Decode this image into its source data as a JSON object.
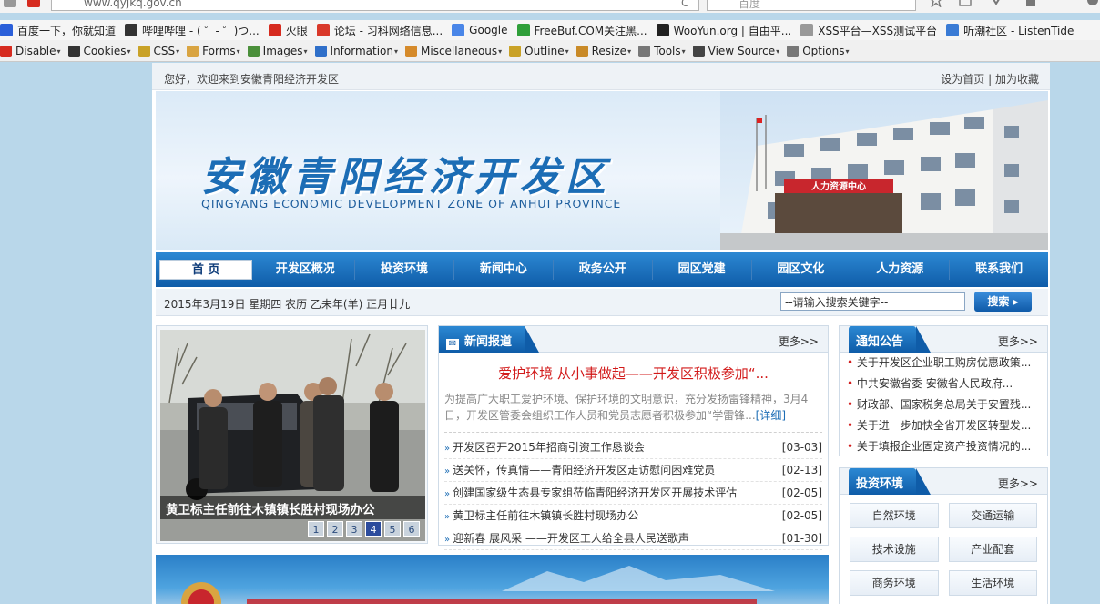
{
  "browser": {
    "url": "www.qyjkq.gov.cn",
    "search_placeholder": "百度",
    "bookmarks": [
      {
        "label": "百度一下，你就知道",
        "icon": "baidu-icon",
        "color": "#2b5fd9"
      },
      {
        "label": "哔哩哔哩 - ( ゜- ゜)つ...",
        "icon": "bilibili-icon",
        "color": "#333333"
      },
      {
        "label": "火眼",
        "icon": "fire-eye-icon",
        "color": "#d62b1f"
      },
      {
        "label": "论坛 - 习科网络信息...",
        "icon": "forum-icon",
        "color": "#d9392a"
      },
      {
        "label": "Google",
        "icon": "google-icon",
        "color": "#4a86e8"
      },
      {
        "label": "FreeBuf.COM关注黑...",
        "icon": "freebuf-icon",
        "color": "#2f9f3a"
      },
      {
        "label": "WooYun.org | 自由平...",
        "icon": "wooyun-icon",
        "color": "#222222"
      },
      {
        "label": "XSS平台—XSS测试平台",
        "icon": "page-icon",
        "color": "#999999"
      },
      {
        "label": "听潮社区 - ListenTide",
        "icon": "listentide-icon",
        "color": "#3a7bd5"
      }
    ],
    "devtools": [
      {
        "label": "Disable",
        "icon": "disable-icon",
        "color": "#d62b1f"
      },
      {
        "label": "Cookies",
        "icon": "cookies-icon",
        "color": "#333333"
      },
      {
        "label": "CSS",
        "icon": "css-icon",
        "color": "#c9a227"
      },
      {
        "label": "Forms",
        "icon": "forms-icon",
        "color": "#d9a441"
      },
      {
        "label": "Images",
        "icon": "images-icon",
        "color": "#4a8f3a"
      },
      {
        "label": "Information",
        "icon": "information-icon",
        "color": "#2f6fc9"
      },
      {
        "label": "Miscellaneous",
        "icon": "miscellaneous-icon",
        "color": "#d58a2a"
      },
      {
        "label": "Outline",
        "icon": "outline-icon",
        "color": "#c9a227"
      },
      {
        "label": "Resize",
        "icon": "resize-icon",
        "color": "#c98a27"
      },
      {
        "label": "Tools",
        "icon": "tools-icon",
        "color": "#777777"
      },
      {
        "label": "View Source",
        "icon": "view-source-icon",
        "color": "#444444"
      },
      {
        "label": "Options",
        "icon": "options-icon",
        "color": "#777777"
      }
    ]
  },
  "site": {
    "welcome": "您好，欢迎来到安徽青阳经济开发区",
    "set_home": "设为首页",
    "separator": "|",
    "add_favorite": "加为收藏",
    "title_cn": "安徽青阳经济开发区",
    "title_en": "QINGYANG ECONOMIC DEVELOPMENT ZONE OF ANHUI PROVINCE",
    "building_sign": "人力资源中心",
    "nav": [
      "首 页",
      "开发区概况",
      "投资环境",
      "新闻中心",
      "政务公开",
      "园区党建",
      "园区文化",
      "人力资源",
      "联系我们"
    ],
    "date": "2015年3月19日 星期四 农历 乙未年(羊) 正月廿九",
    "search_value": "--请输入搜索关键字--",
    "search_button": "搜索",
    "photo_caption": "黄卫标主任前往木镇镇长胜村现场办公",
    "photo_pages": [
      "1",
      "2",
      "3",
      "4",
      "5",
      "6"
    ],
    "photo_active_page": "4",
    "news": {
      "title": "新闻报道",
      "more": "更多>>",
      "headline": "爱护环境 从小事做起——开发区积极参加“...",
      "summary": "为提高广大职工爱护环境、保护环境的文明意识，充分发扬雷锋精神，3月4日，开发区管委会组织工作人员和党员志愿者积极参加“学雷锋...",
      "detail": "[详细]",
      "items": [
        {
          "title": "开发区召开2015年招商引资工作恳谈会",
          "date": "[03-03]"
        },
        {
          "title": "送关怀，传真情——青阳经济开发区走访慰问困难党员",
          "date": "[02-13]"
        },
        {
          "title": "创建国家级生态县专家组莅临青阳经济开发区开展技术评估",
          "date": "[02-05]"
        },
        {
          "title": "黄卫标主任前往木镇镇长胜村现场办公",
          "date": "[02-05]"
        },
        {
          "title": "迎新春 展风采 ——开发区工人给全县人民送歌声",
          "date": "[01-30]"
        }
      ]
    },
    "notice": {
      "title": "通知公告",
      "more": "更多>>",
      "items": [
        "关于开发区企业职工购房优惠政策...",
        "中共安徽省委 安徽省人民政府...",
        "财政部、国家税务总局关于安置残...",
        "关于进一步加快全省开发区转型发...",
        "关于填报企业固定资产投资情况的..."
      ]
    },
    "invest": {
      "title": "投资环境",
      "more": "更多>>",
      "items": [
        "自然环境",
        "交通运输",
        "技术设施",
        "产业配套",
        "商务环境",
        "生活环境"
      ]
    }
  }
}
